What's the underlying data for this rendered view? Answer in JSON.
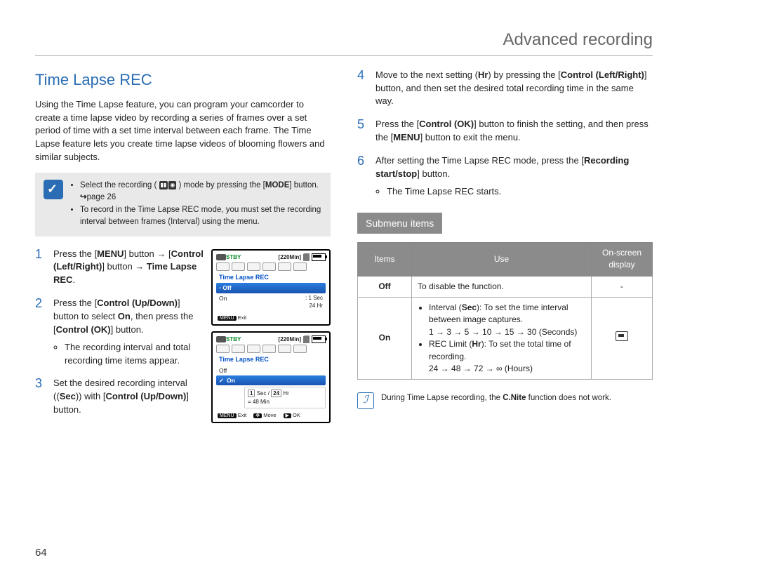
{
  "header": {
    "section": "Advanced recording"
  },
  "page_number": "64",
  "title": "Time Lapse REC",
  "intro": "Using the Time Lapse feature, you can program your camcorder to create a time lapse video by recording a series of frames over a set period of time with a set time interval between each frame. The Time Lapse feature lets you create time lapse videos of blooming flowers and similar subjects.",
  "note": {
    "line1_a": "Select the recording (",
    "line1_b": ") mode by pressing the [",
    "line1_c": "] button. ",
    "mode_btn": "MODE",
    "page_ref": "page 26",
    "line2": "To record in the Time Lapse REC mode, you must set the recording interval between frames (Interval) using the menu."
  },
  "steps_left": {
    "s1_a": "Press the [",
    "s1_b": "] button → [",
    "s1_c": "] button → ",
    "menu_btn": "MENU",
    "ctrl_lr": "Control (Left/Right)",
    "timelapse": "Time Lapse REC",
    "s1_end": ".",
    "s2_a": "Press the [",
    "s2_b": "] button to select ",
    "s2_c": ", then press the [",
    "s2_d": "] button.",
    "ctrl_ud": "Control (Up/Down)",
    "on_word": "On",
    "ctrl_ok": "Control (OK)",
    "s2_bullet": "The recording interval and total recording time items appear.",
    "s3_a": "Set the desired recording interval (",
    "s3_b": ") with [",
    "s3_c": "] button.",
    "sec_word": "Sec"
  },
  "steps_right": {
    "s4_a": "Move to the next setting (",
    "s4_hr": "Hr",
    "s4_b": ") by pressing the [",
    "s4_ctrl": "Control (Left/Right)",
    "s4_c": "] button, and then set the desired total recording time in the same way.",
    "s5_a": "Press the [",
    "s5_ok": "Control (OK)",
    "s5_b": "] button to finish the setting, and then press the [",
    "s5_menu": "MENU",
    "s5_c": "] button to exit the menu.",
    "s6_a": "After setting the Time Lapse REC mode, press the [",
    "s6_btn": "Recording start/stop",
    "s6_b": "] button.",
    "s6_bullet": "The Time Lapse REC starts."
  },
  "lcd1": {
    "stby": "STBY",
    "remain": "220Min",
    "menu_name": "Time Lapse REC",
    "item_off": "Off",
    "item_on": "On",
    "right_sec": ": 1 Sec",
    "right_hr": "24 Hr",
    "exit": "Exit",
    "menu_tag": "MENU"
  },
  "lcd2": {
    "stby": "STBY",
    "remain": "220Min",
    "menu_name": "Time Lapse REC",
    "item_off": "Off",
    "item_on": "On",
    "sec_box": "1",
    "sec_lbl": "Sec /",
    "hr_box": "24",
    "hr_lbl": "Hr",
    "est": "= 48 Min",
    "exit": "Exit",
    "move": "Move",
    "ok": "OK",
    "menu_tag": "MENU"
  },
  "submenu_label": "Submenu items",
  "table": {
    "h_items": "Items",
    "h_use": "Use",
    "h_osd": "On-screen display",
    "row_off_item": "Off",
    "row_off_use": "To disable the function.",
    "row_off_osd": "-",
    "row_on_item": "On",
    "row_on_b1_a": "Interval (",
    "row_on_b1_sec": "Sec",
    "row_on_b1_b": "): To set the time interval between image captures.",
    "row_on_b1_seq": "1 → 3 → 5 → 10 → 15 → 30 (Seconds)",
    "row_on_b2_a": "REC Limit (",
    "row_on_b2_hr": "Hr",
    "row_on_b2_b": "): To set the total time of recording.",
    "row_on_b2_seq": "24 → 48 → 72 → ∞ (Hours)"
  },
  "info_a": "During Time Lapse recording, the ",
  "info_cnite": "C.Nite",
  "info_b": " function does not work."
}
